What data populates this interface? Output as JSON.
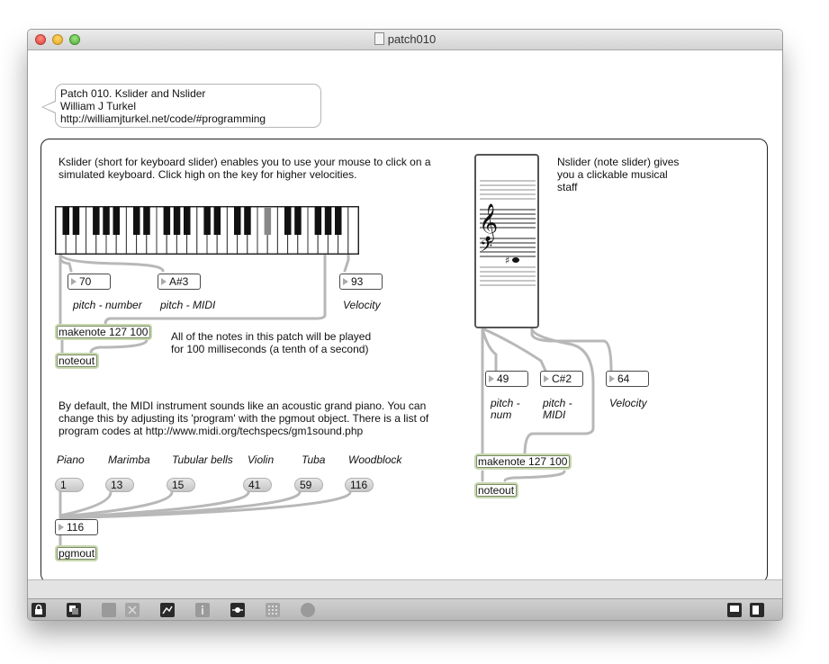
{
  "window": {
    "title": "patch010"
  },
  "header_comment": {
    "line1": "Patch 010. Kslider and Nslider",
    "line2": "William J Turkel",
    "line3": "http://williamjturkel.net/code/#programming"
  },
  "kslider_section": {
    "desc_line1": "Kslider (short for keyboard slider) enables you to use your mouse to click on a",
    "desc_line2": "simulated keyboard. Click high on the key for higher velocities.",
    "pitch_number": "70",
    "pitch_midi": "A#3",
    "velocity": "93",
    "pitch_number_label": "pitch - number",
    "pitch_midi_label": "pitch - MIDI",
    "velocity_label": "Velocity",
    "makenote": "makenote 127 100",
    "noteout": "noteout",
    "note_line1": "All of the notes in this patch will be played",
    "note_line2": "for 100 milliseconds (a tenth of a second)"
  },
  "program_section": {
    "desc_line1": "By default, the MIDI instrument sounds like an acoustic grand piano. You can",
    "desc_line2": "change this by adjusting its 'program' with the pgmout object. There is a list of",
    "desc_line3": "program codes at http://www.midi.org/techspecs/gm1sound.php",
    "instruments": [
      {
        "label": "Piano",
        "value": "1"
      },
      {
        "label": "Marimba",
        "value": "13"
      },
      {
        "label": "Tubular bells",
        "value": "15"
      },
      {
        "label": "Violin",
        "value": "41"
      },
      {
        "label": "Tuba",
        "value": "59"
      },
      {
        "label": "Woodblock",
        "value": "116"
      }
    ],
    "program_number": "116",
    "pgmout": "pgmout"
  },
  "nslider_section": {
    "desc_line1": "Nslider (note slider) gives",
    "desc_line2": "you a clickable musical",
    "desc_line3": "staff",
    "pitch_num": "49",
    "pitch_midi": "C#2",
    "velocity": "64",
    "pitch_num_label_1": "pitch -",
    "pitch_num_label_2": "num",
    "pitch_midi_label_1": "pitch -",
    "pitch_midi_label_2": "MIDI",
    "velocity_label": "Velocity",
    "makenote": "makenote 127 100",
    "noteout": "noteout"
  },
  "toolbar": {
    "icons": [
      "lock-icon",
      "presentation-icon",
      "edit-icon",
      "delete-icon",
      "inspector-toggle-icon",
      "info-icon",
      "connect-icon",
      "grid-icon",
      "clock-icon",
      "sidebar-left-icon",
      "sidebar-right-icon"
    ]
  }
}
